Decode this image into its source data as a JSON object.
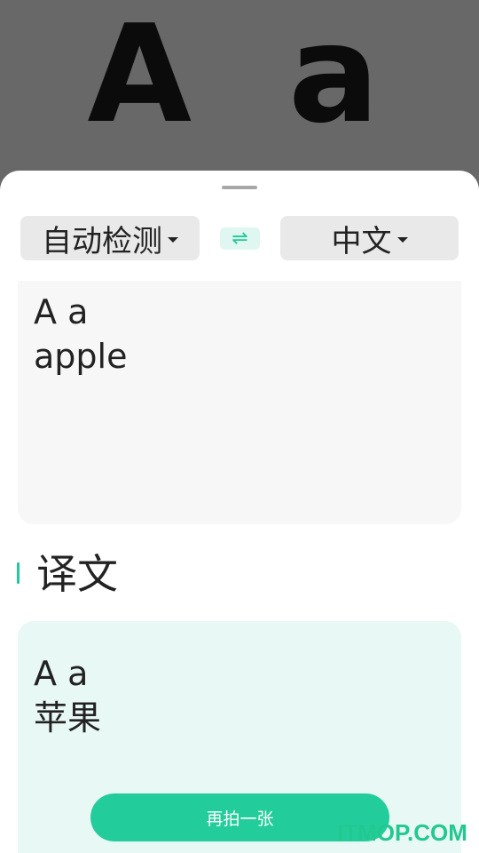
{
  "camera_preview": {
    "captured_text": "A a"
  },
  "language_bar": {
    "source_language": "自动检测",
    "target_language": "中文",
    "swap_icon": "⇌"
  },
  "source": {
    "lines": [
      "A a",
      "apple"
    ]
  },
  "result": {
    "heading": "译文",
    "lines": [
      "A a",
      "苹果"
    ]
  },
  "actions": {
    "retake_label": "再拍一张"
  },
  "watermark": "ITMOP.COM",
  "colors": {
    "accent": "#23cd9b",
    "result_bg": "#e8f8f4",
    "source_bg": "#f7f7f7",
    "preview_bg": "#686868"
  }
}
